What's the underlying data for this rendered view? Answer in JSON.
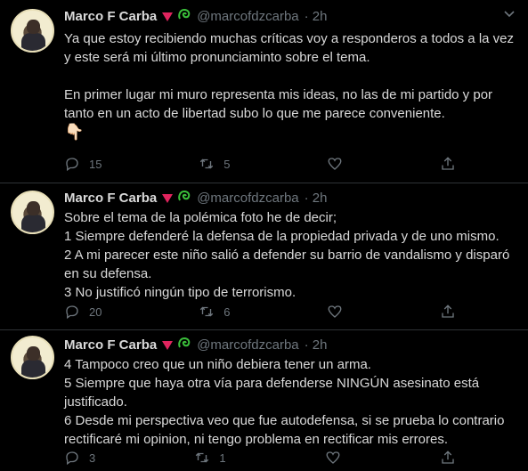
{
  "colors": {
    "background": "#000000",
    "text": "#d9d9d9",
    "secondary": "#6e767d",
    "divider": "#2f3336",
    "emoji_triangle": "#e0245e",
    "emoji_green": "#3bbf3b"
  },
  "tweets": [
    {
      "name": "Marco F Carba",
      "handle": "@marcofdzcarba",
      "time": "· 2h",
      "more_icon": "more-icon",
      "lines": [
        "Ya que estoy recibiendo muchas críticas voy a responderos a todos a la vez y este será mi último pronunciaminto sobre el tema.",
        "En primer lugar mi muro representa mis ideas, no las de mi partido y por tanto en un acto de libertad subo lo que me parece conveniente."
      ],
      "hand_emoji": "👇🏻",
      "reply_count": "15",
      "retweet_count": "5"
    },
    {
      "name": "Marco F Carba",
      "handle": "@marcofdzcarba",
      "time": "· 2h",
      "lines": [
        "Sobre el tema de la polémica foto he de decir;",
        "1 Siempre defenderé la defensa de la propiedad privada y de uno mismo.",
        "2 A mi parecer este niño salió a defender su barrio de vandalismo y disparó en su defensa.",
        "3 No justificó ningún tipo de terrorismo."
      ],
      "reply_count": "20",
      "retweet_count": "6"
    },
    {
      "name": "Marco F Carba",
      "handle": "@marcofdzcarba",
      "time": "· 2h",
      "lines": [
        "4 Tampoco creo que un niño debiera tener un arma.",
        "5 Siempre que haya otra vía para defenderse  NINGÚN asesinato está justificado.",
        "6 Desde mi perspectiva veo que fue autodefensa, si se prueba lo contrario rectificaré mi opinion, ni tengo problema en rectificar mis errores."
      ],
      "reply_count": "3",
      "retweet_count": "1"
    }
  ],
  "emoji_symbols": {
    "green": "ඞ",
    "more": "⌄"
  }
}
